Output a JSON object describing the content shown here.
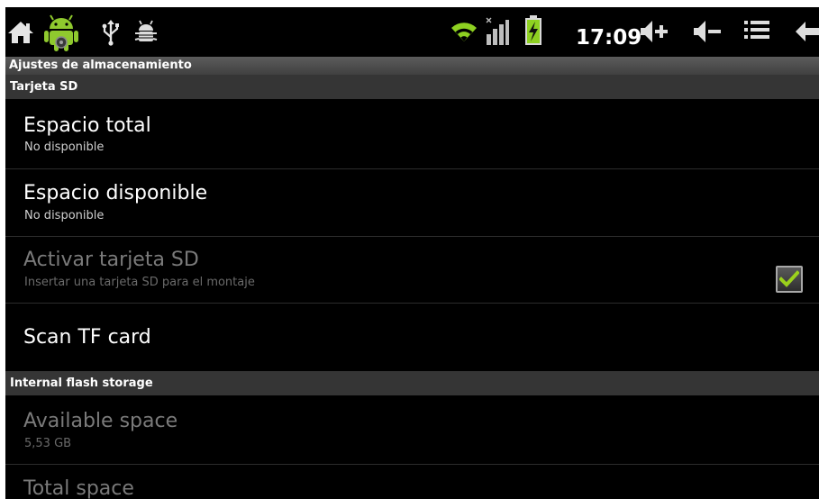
{
  "status_bar": {
    "time": "17:09",
    "icons": [
      "home-icon",
      "android-robot-icon",
      "usb-icon",
      "debug-icon",
      "wifi-icon",
      "signal-icon",
      "battery-charging-icon",
      "volume-up-icon",
      "volume-down-icon",
      "menu-icon",
      "back-icon"
    ],
    "colors": {
      "accent_green": "#9bd11c",
      "background": "#000000",
      "foreground": "#ffffff"
    }
  },
  "screen_title": "Ajustes de almacenamiento",
  "sections": [
    {
      "header": "Tarjeta SD",
      "items": [
        {
          "title": "Espacio total",
          "summary": "No disponible",
          "enabled": true
        },
        {
          "title": "Espacio disponible",
          "summary": "No disponible",
          "enabled": true
        },
        {
          "title": "Activar tarjeta SD",
          "summary": "Insertar una tarjeta SD para el montaje",
          "enabled": false
        },
        {
          "title": "Scan TF card",
          "summary": "",
          "enabled": true,
          "checked": true
        }
      ]
    },
    {
      "header": "Internal flash storage",
      "items": [
        {
          "title": "Available space",
          "summary": "5,53 GB",
          "enabled": false
        },
        {
          "title": "Total space",
          "summary": "",
          "enabled": false
        }
      ]
    }
  ]
}
